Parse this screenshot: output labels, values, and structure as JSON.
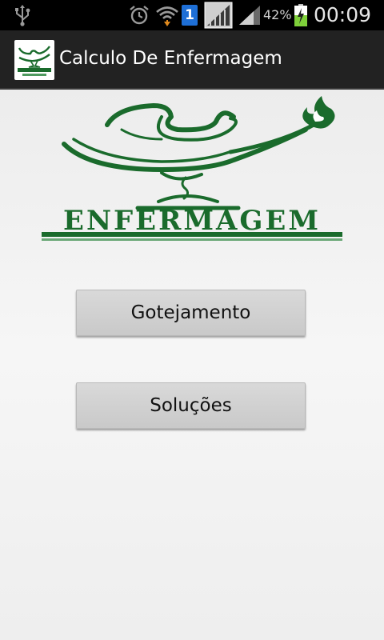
{
  "status_bar": {
    "battery_percent": "42%",
    "time": "00:09",
    "sim_badge": "1",
    "icons": [
      "usb-icon",
      "alarm-icon",
      "wifi-icon",
      "sim-icon",
      "signal-icon",
      "battery-icon"
    ]
  },
  "action_bar": {
    "title": "Calculo De Enfermagem",
    "app_icon": "lamp-logo-icon"
  },
  "logo": {
    "text": "ENFERMAGEM",
    "color": "#1a6b2c"
  },
  "buttons": {
    "gotejamento": "Gotejamento",
    "solucoes": "Soluções"
  },
  "colors": {
    "status_bar": "#000000",
    "action_bar": "#222222",
    "brand_green": "#1a6b2c",
    "button": "#d0d0d0"
  }
}
